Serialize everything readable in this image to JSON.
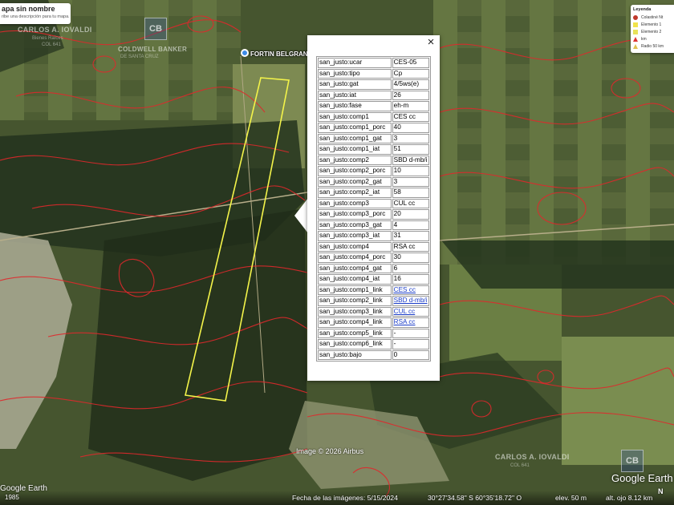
{
  "map_title": {
    "name": "apa sin nombre",
    "description": "ribe una descripción para tu mapa."
  },
  "legend": {
    "title": "Leyenda",
    "items": [
      {
        "label": "Colastiné Nt",
        "color": "#c0392b"
      },
      {
        "label": "Elemento 1",
        "color": "#f1e34a"
      },
      {
        "label": "Elemento 2",
        "color": "#e8e25a"
      },
      {
        "label": "km",
        "color": "#d33"
      },
      {
        "label": "Radio 50 km",
        "color": "#e0c050"
      }
    ]
  },
  "placemark": {
    "label": "FORTIN BELGRANO",
    "color": "#3c8be8"
  },
  "polygon_color": "#f4f44a",
  "soil_line_color": "#e0282c",
  "watermarks": {
    "top_name": "CARLOS A. IOVALDI",
    "top_sub1": "Bienes Raíces",
    "top_sub2": "COL 641",
    "top_brand": "COLDWELL BANKER",
    "top_brand_sub": "DE SANTA CRUZ",
    "bottom_name": "CARLOS A. IOVALDI",
    "bottom_sub": "COL 641"
  },
  "popup": {
    "close_label": "×",
    "rows": [
      {
        "key": "san_justo:ucar",
        "value": "CES-05",
        "link": false
      },
      {
        "key": "san_justo:tipo",
        "value": "Cp",
        "link": false
      },
      {
        "key": "san_justo:gat",
        "value": "4/5ws(e)",
        "link": false
      },
      {
        "key": "san_justo:iat",
        "value": "26",
        "link": false
      },
      {
        "key": "san_justo:fase",
        "value": "eh-m",
        "link": false
      },
      {
        "key": "san_justo:comp1",
        "value": "CES cc",
        "link": false
      },
      {
        "key": "san_justo:comp1_porc",
        "value": "40",
        "link": false
      },
      {
        "key": "san_justo:comp1_gat",
        "value": "3",
        "link": false
      },
      {
        "key": "san_justo:comp1_iat",
        "value": "51",
        "link": false
      },
      {
        "key": "san_justo:comp2",
        "value": "SBD d-mb/i",
        "link": false
      },
      {
        "key": "san_justo:comp2_porc",
        "value": "10",
        "link": false
      },
      {
        "key": "san_justo:comp2_gat",
        "value": "3",
        "link": false
      },
      {
        "key": "san_justo:comp2_iat",
        "value": "58",
        "link": false
      },
      {
        "key": "san_justo:comp3",
        "value": "CUL cc",
        "link": false
      },
      {
        "key": "san_justo:comp3_porc",
        "value": "20",
        "link": false
      },
      {
        "key": "san_justo:comp3_gat",
        "value": "4",
        "link": false
      },
      {
        "key": "san_justo:comp3_iat",
        "value": "31",
        "link": false
      },
      {
        "key": "san_justo:comp4",
        "value": "RSA cc",
        "link": false
      },
      {
        "key": "san_justo:comp4_porc",
        "value": "30",
        "link": false
      },
      {
        "key": "san_justo:comp4_gat",
        "value": "6",
        "link": false
      },
      {
        "key": "san_justo:comp4_iat",
        "value": "16",
        "link": false
      },
      {
        "key": "san_justo:comp1_link",
        "value": "CES cc",
        "link": true
      },
      {
        "key": "san_justo:comp2_link",
        "value": "SBD d-mb/i",
        "link": true
      },
      {
        "key": "san_justo:comp3_link",
        "value": "CUL cc",
        "link": true
      },
      {
        "key": "san_justo:comp4_link",
        "value": "RSA cc",
        "link": true
      },
      {
        "key": "san_justo:comp5_link",
        "value": "-",
        "link": false
      },
      {
        "key": "san_justo:comp6_link",
        "value": "-",
        "link": false
      },
      {
        "key": "san_justo:bajo",
        "value": "0",
        "link": false
      }
    ]
  },
  "footer": {
    "image_credit": "Image © 2026 Airbus",
    "google_earth": "Google Earth",
    "year": "1985",
    "imagery_date": "Fecha de las imágenes: 5/15/2024",
    "coords": "30°27'34.58\" S   60°35'18.72\" O",
    "elevation": "elev.   50 m",
    "eye_alt": "alt. ojo   8.12 km",
    "north": "N"
  }
}
